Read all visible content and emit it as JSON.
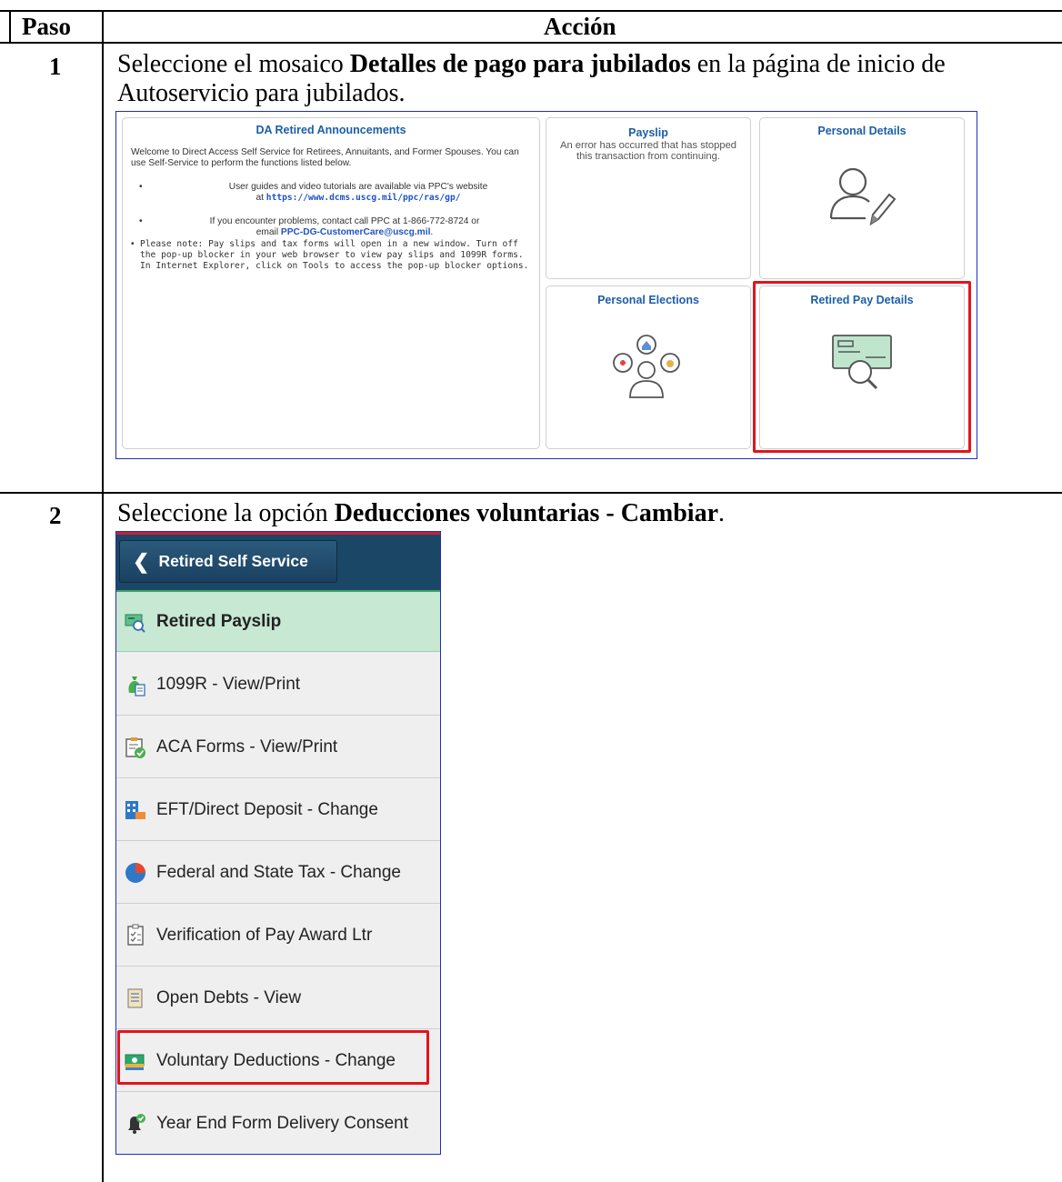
{
  "table": {
    "col_step": "Paso",
    "col_action": "Acción",
    "rows": [
      {
        "step": "1",
        "text_before": "Seleccione el  mosaico ",
        "text_bold": "Detalles de pago para jubilados",
        "text_after": " en la página de inicio de Autoservicio para jubilados."
      },
      {
        "step": "2",
        "text_before": "Seleccione la  opción ",
        "text_bold": "Deducciones voluntarias - Cambiar",
        "text_after": "."
      }
    ]
  },
  "homepage": {
    "announcements": {
      "title": "DA Retired Announcements",
      "intro": "Welcome to Direct Access Self Service for Retirees, Annuitants, and Former Spouses. You can use Self-Service to perform the functions listed below.",
      "bullet1_line1": "User guides and video tutorials are available via PPC's website",
      "bullet1_at": "at ",
      "bullet1_link": "https://www.dcms.uscg.mil/ppc/ras/gp/",
      "bullet2_line1": "If you encounter problems, contact call PPC at 1-866-772-8724 or",
      "bullet2_email_prefix": "email ",
      "bullet2_email": "PPC-DG-CustomerCare@uscg.mil",
      "bullet2_end": ".",
      "note": "Please note: Pay slips and tax forms will open in a new window. Turn off the pop-up blocker in your web browser to view pay slips and 1099R forms. In Internet Explorer, click on Tools to access the pop-up blocker options."
    },
    "payslip": {
      "title": "Payslip",
      "error": "An error has occurred that has stopped this transaction from continuing."
    },
    "personal_details": {
      "title": "Personal Details",
      "icon": "person-edit-icon"
    },
    "personal_elections": {
      "title": "Personal Elections",
      "icon": "person-elections-icon"
    },
    "retired_pay_details": {
      "title": "Retired Pay Details",
      "icon": "check-magnify-icon"
    }
  },
  "nav": {
    "back_label": "Retired Self Service",
    "items": [
      {
        "label": "Retired Payslip",
        "icon": "payslip-icon",
        "active": true
      },
      {
        "label": "1099R - View/Print",
        "icon": "money-bag-icon"
      },
      {
        "label": "ACA Forms - View/Print",
        "icon": "clipboard-check-icon"
      },
      {
        "label": "EFT/Direct Deposit - Change",
        "icon": "bank-building-icon"
      },
      {
        "label": "Federal and State Tax - Change",
        "icon": "pie-chart-icon"
      },
      {
        "label": "Verification of Pay Award Ltr",
        "icon": "checklist-icon"
      },
      {
        "label": "Open Debts - View",
        "icon": "document-list-icon"
      },
      {
        "label": "Voluntary Deductions - Change",
        "icon": "cash-stack-icon",
        "highlighted": true
      },
      {
        "label": "Year End Form Delivery Consent",
        "icon": "bell-check-icon"
      }
    ]
  },
  "colors": {
    "highlight_red": "#e3141b",
    "tile_title_blue": "#1c5ea8",
    "nav_header": "#1b4766",
    "nav_active": "#c7e8d2"
  }
}
